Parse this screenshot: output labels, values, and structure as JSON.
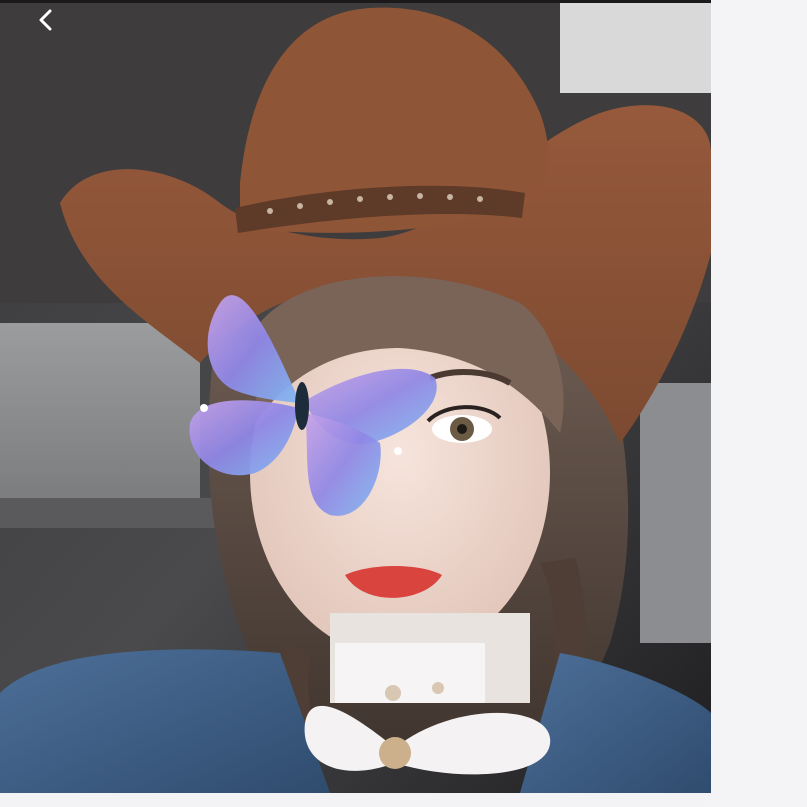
{
  "viewer": {
    "back_icon": "chevron-left-icon",
    "photo_subject": "selfie-with-cowboy-hat-and-butterfly-filter"
  },
  "colors": {
    "background": "#f3f3f5",
    "hat": "#8a5236",
    "denim": "#3f5f86"
  }
}
